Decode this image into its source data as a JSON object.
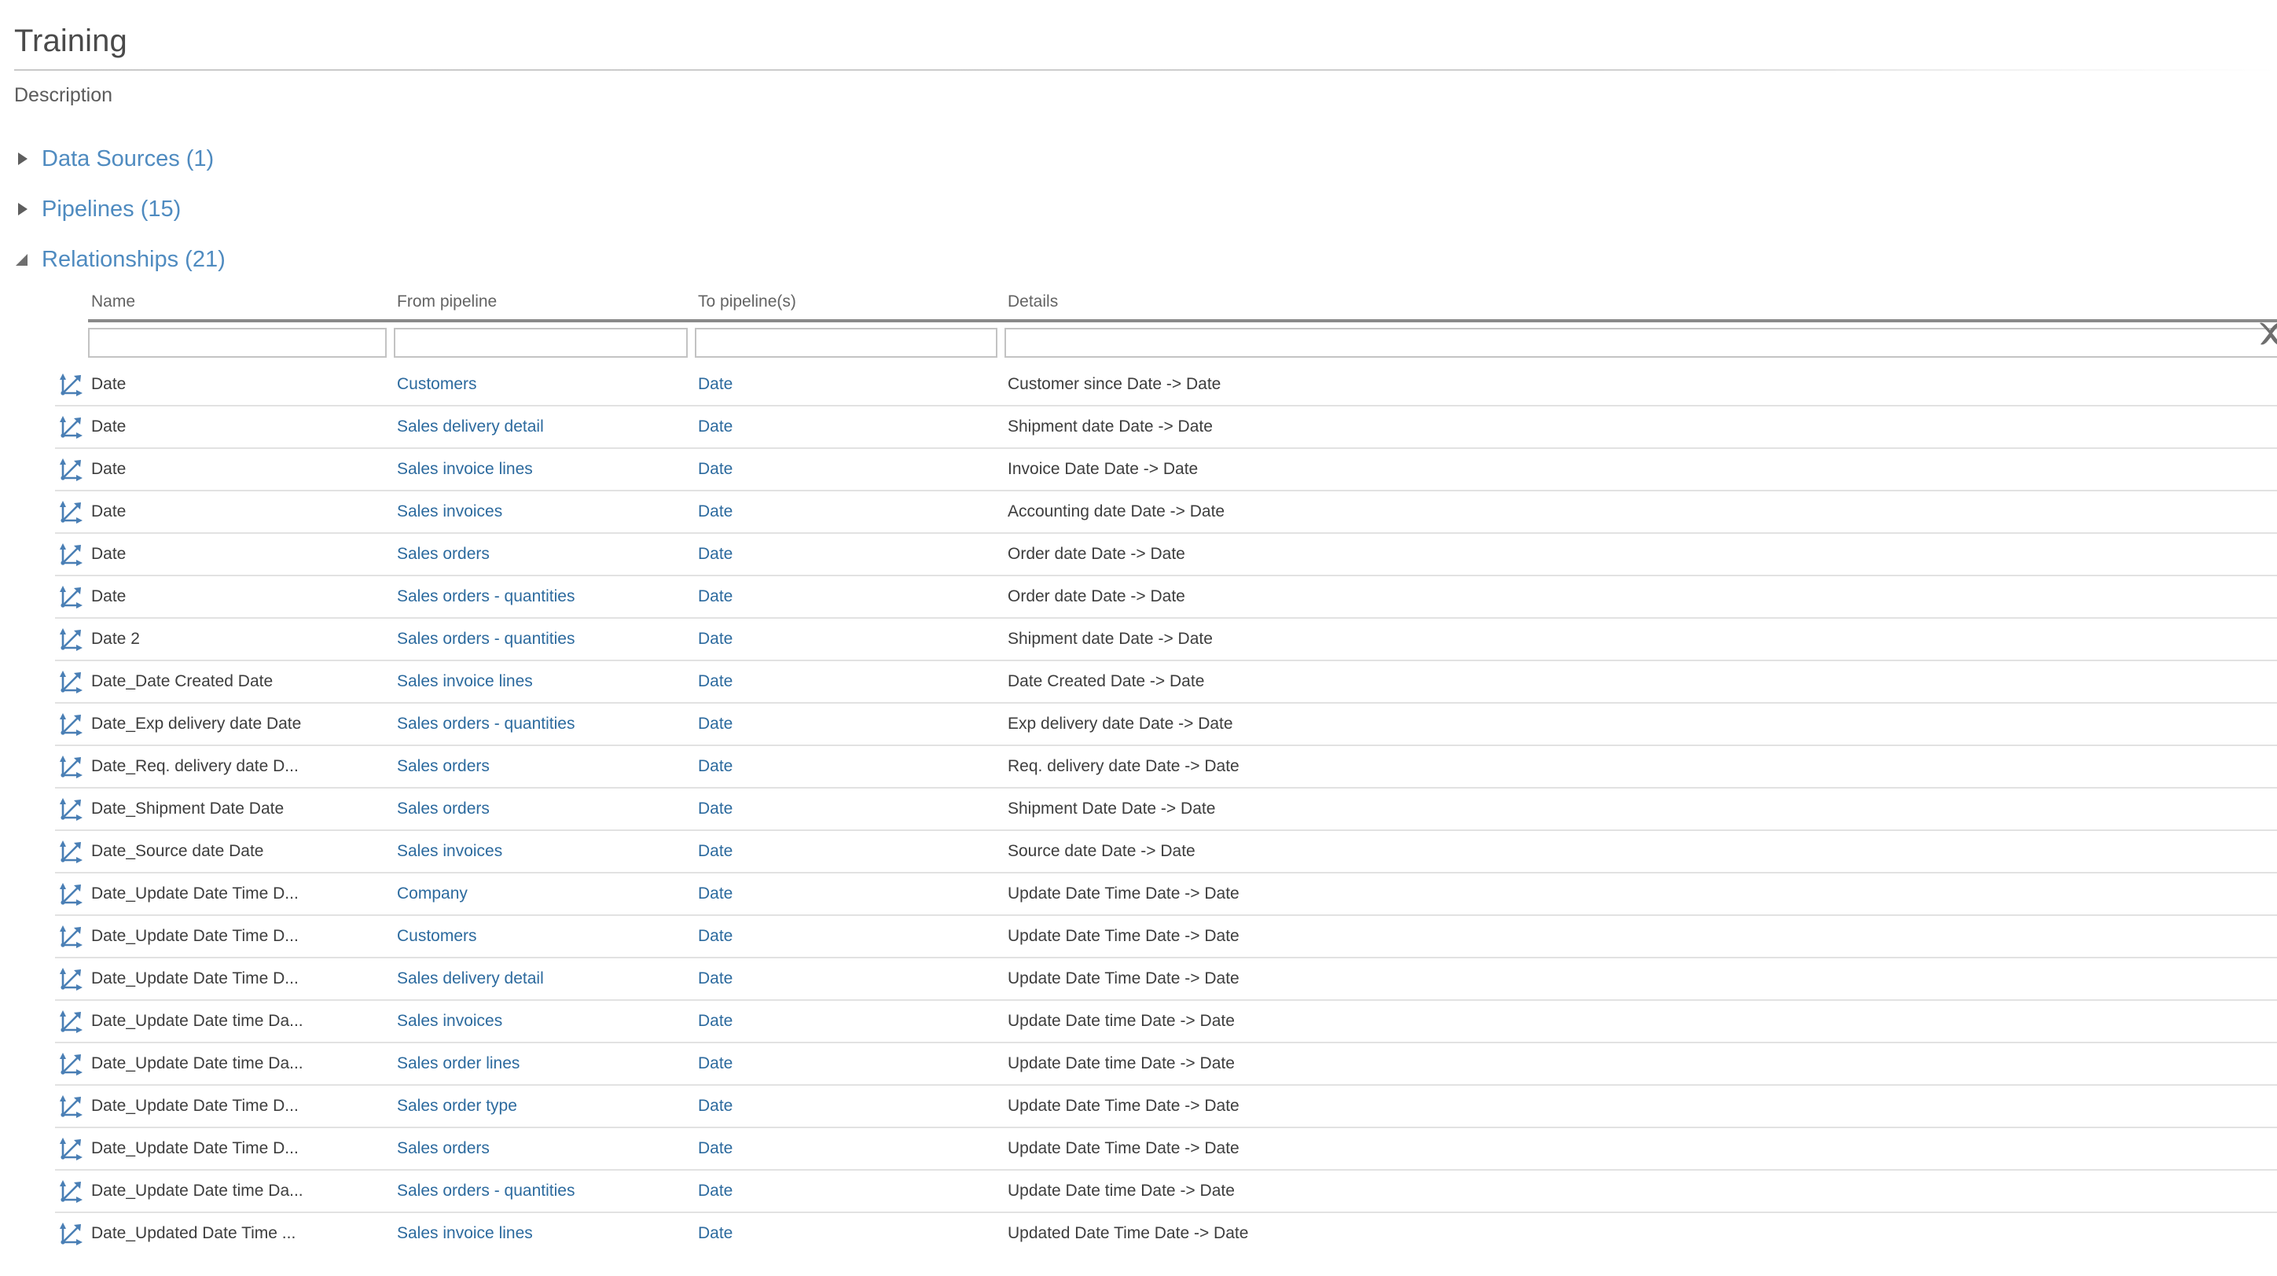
{
  "page": {
    "title": "Training",
    "description": "Description"
  },
  "sections": [
    {
      "label": "Data Sources (1)",
      "state": "collapsed",
      "name": "data-sources"
    },
    {
      "label": "Pipelines (15)",
      "state": "collapsed",
      "name": "pipelines"
    },
    {
      "label": "Relationships (21)",
      "state": "expanded",
      "name": "relationships"
    }
  ],
  "table": {
    "columns": [
      "Name",
      "From pipeline",
      "To pipeline(s)",
      "Details"
    ],
    "filters": {
      "name": "",
      "from_pipeline": "",
      "to_pipeline": "",
      "details": "",
      "placeholder": ""
    },
    "clear_filter_icon": "close-icon",
    "row_icon": "relationship-axes-icon",
    "rows": [
      {
        "name": "Date",
        "from": "Customers",
        "to": "Date",
        "details": "Customer since Date -> Date"
      },
      {
        "name": "Date",
        "from": "Sales delivery detail",
        "to": "Date",
        "details": "Shipment date Date -> Date"
      },
      {
        "name": "Date",
        "from": "Sales invoice lines",
        "to": "Date",
        "details": "Invoice Date Date -> Date"
      },
      {
        "name": "Date",
        "from": "Sales invoices",
        "to": "Date",
        "details": "Accounting date Date -> Date"
      },
      {
        "name": "Date",
        "from": "Sales orders",
        "to": "Date",
        "details": "Order date Date -> Date"
      },
      {
        "name": "Date",
        "from": "Sales orders - quantities",
        "to": "Date",
        "details": "Order date Date -> Date"
      },
      {
        "name": "Date 2",
        "from": "Sales orders - quantities",
        "to": "Date",
        "details": "Shipment date Date -> Date"
      },
      {
        "name": "Date_Date Created Date",
        "from": "Sales invoice lines",
        "to": "Date",
        "details": "Date Created Date -> Date"
      },
      {
        "name": "Date_Exp delivery date Date",
        "from": "Sales orders - quantities",
        "to": "Date",
        "details": "Exp delivery date Date -> Date"
      },
      {
        "name": "Date_Req. delivery date D...",
        "from": "Sales orders",
        "to": "Date",
        "details": "Req. delivery date Date -> Date"
      },
      {
        "name": "Date_Shipment Date Date",
        "from": "Sales orders",
        "to": "Date",
        "details": "Shipment Date Date -> Date"
      },
      {
        "name": "Date_Source date Date",
        "from": "Sales invoices",
        "to": "Date",
        "details": "Source date Date -> Date"
      },
      {
        "name": "Date_Update Date Time D...",
        "from": "Company",
        "to": "Date",
        "details": "Update Date Time Date -> Date"
      },
      {
        "name": "Date_Update Date Time D...",
        "from": "Customers",
        "to": "Date",
        "details": "Update Date Time Date -> Date"
      },
      {
        "name": "Date_Update Date Time D...",
        "from": "Sales delivery detail",
        "to": "Date",
        "details": "Update Date Time Date -> Date"
      },
      {
        "name": "Date_Update Date time Da...",
        "from": "Sales invoices",
        "to": "Date",
        "details": "Update Date time Date -> Date"
      },
      {
        "name": "Date_Update Date time Da...",
        "from": "Sales order lines",
        "to": "Date",
        "details": "Update Date time Date -> Date"
      },
      {
        "name": "Date_Update Date Time D...",
        "from": "Sales order type",
        "to": "Date",
        "details": "Update Date Time Date -> Date"
      },
      {
        "name": "Date_Update Date Time D...",
        "from": "Sales orders",
        "to": "Date",
        "details": "Update Date Time Date -> Date"
      },
      {
        "name": "Date_Update Date time Da...",
        "from": "Sales orders - quantities",
        "to": "Date",
        "details": "Update Date time Date -> Date"
      },
      {
        "name": "Date_Updated Date Time ...",
        "from": "Sales invoice lines",
        "to": "Date",
        "details": "Updated Date Time Date -> Date"
      }
    ]
  },
  "colors": {
    "link_blue": "#2c6a9e",
    "section_blue": "#4f8bc0",
    "icon_blue": "#4a7fb5",
    "header_rule": "#8a8a8a",
    "row_divider": "#e2e2e2"
  }
}
